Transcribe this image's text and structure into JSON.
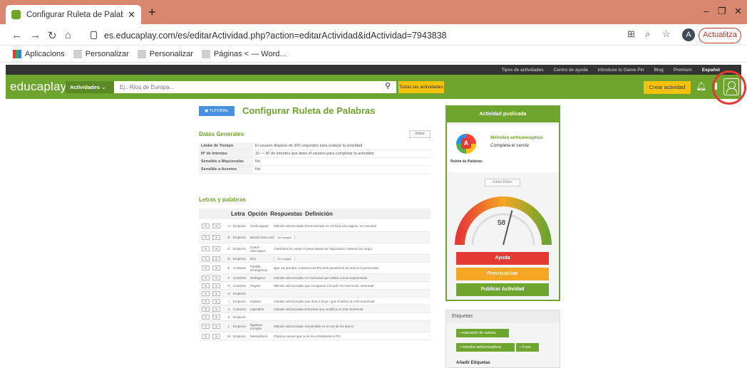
{
  "browser": {
    "tab_title": "Configurar Ruleta de Palabras - E",
    "tab_close": "✕",
    "new_tab": "+",
    "url": "es.educaplay.com/es/editarActividad.php?action=editarActividad&idActividad=7943838",
    "profile_initial": "A",
    "update_button": "Actualitza",
    "bookmarks": [
      "Aplicacions",
      "Personalizar",
      "Personalizar",
      "Páginas < — Word..."
    ]
  },
  "site": {
    "top_links": [
      "Tipos de actividades",
      "Centro de ayuda",
      "Introduce tu Game Pin",
      "Blog",
      "Premium",
      "Español"
    ],
    "logo": "educaplay",
    "activities_dropdown": "Actividades",
    "search_placeholder": "Ej.: Ríos de Europa...",
    "all_activities_button": "Todas las actividades",
    "create_activity_button": "Crear actividad"
  },
  "main": {
    "tutorial_button": "TUTORIAL",
    "title": "Configurar Ruleta de Palabras",
    "general_section": "Datos Generales",
    "edit_button": "Editar",
    "general_rows": [
      {
        "k": "Límite de Tiempo",
        "v": "El usuario dispone de 300 segundos para realizar la actividad"
      },
      {
        "k": "Nº de Intentos",
        "v": "10 — Nº de intentos que tiene el usuario para completar la actividad"
      },
      {
        "k": "Sensible a Mayúsculas",
        "v": "No"
      },
      {
        "k": "Sensible a Acentos",
        "v": "No"
      }
    ],
    "letters_section": "Letras y palabras",
    "letters_header": [
      "Letra",
      "Opción",
      "Respuestas",
      "Definición"
    ],
    "letters": [
      {
        "l": "A",
        "o": "Empieza",
        "r": "Anell vaginal",
        "d": "Mètode anticonceptiu hormonal que es col·loca a la vagina i es mensual"
      },
      {
        "l": "B",
        "o": "Empieza",
        "r": "Bando sexe oral",
        "d": "Ver imagen",
        "img": true
      },
      {
        "l": "C",
        "o": "Empieza",
        "r": "Coitus interruptus",
        "d": "Consisteix en retirar el penis abans de l'ejaculació, mètode poc segur"
      },
      {
        "l": "D",
        "o": "Empieza",
        "r": "DIU",
        "d": "Ver imagen",
        "img": true
      },
      {
        "l": "E",
        "o": "Contiene",
        "r": "Pastilla Emergència",
        "d": "Que cal prendre si durant una RS amb penetració es trenca el preservatiu"
      },
      {
        "l": "F",
        "o": "Contiene",
        "r": "Diafragma",
        "d": "mètode anticonceptiu no hormonal que utilitza crema espermicida"
      },
      {
        "l": "G",
        "o": "Contiene",
        "r": "Pegats",
        "d": "Mètode anticonceptiu que s'enganxa a la pell i és hormonal i setmanal"
      },
      {
        "l": "H",
        "o": "Empieza",
        "r": "",
        "d": ""
      },
      {
        "l": "I",
        "o": "Empieza",
        "r": "Implant",
        "d": "mètode anticonceptiu que dura 3 anys i que modifica el cicle menstrual"
      },
      {
        "l": "J",
        "o": "Contiene",
        "r": "Injectable",
        "d": "mètode anticonceptiu trimestral que modifica el cicle menstrual"
      },
      {
        "l": "K",
        "o": "Empieza",
        "r": "",
        "d": ""
      },
      {
        "l": "L",
        "o": "Empieza",
        "r": "lligadura trompes",
        "d": "Mètode anticonceptiu irreversible en el cas de les dones"
      },
      {
        "l": "M",
        "o": "Empieza",
        "r": "Masturbació",
        "d": "Pràctica sexual que no té risc d'embaràs ni ITS"
      }
    ]
  },
  "card": {
    "header": "Actividad publicada",
    "game_type": "Ruleta de Palabras",
    "game_name": "Métodes anticonceptius",
    "game_desc": "Completa el cercle",
    "edit_data": "Editar Datos",
    "gauge_value": "58",
    "gauge_fraction": 0.58,
    "help": "Ayuda",
    "preview": "Previsualizar",
    "publish": "Publicar Actividad"
  },
  "tags": {
    "header": "Etiquetas",
    "items": [
      "educación de valores",
      "métodos anticonceptivos",
      "3 eso"
    ],
    "add_label": "Añadir Etiquetas"
  },
  "colors": {
    "brand_green": "#6ea52e",
    "accent_yellow": "#f4c20d",
    "danger_red": "#e53935",
    "orange": "#f5a623"
  }
}
